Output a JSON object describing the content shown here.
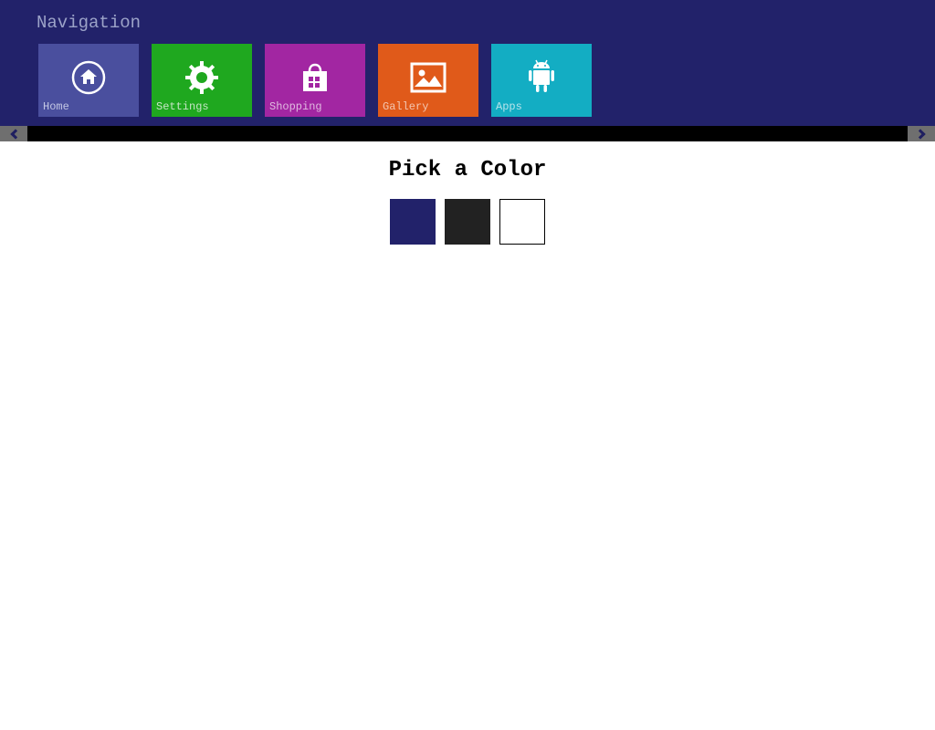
{
  "nav": {
    "title": "Navigation",
    "tiles": [
      {
        "label": "Home",
        "color": "#4a4f9e"
      },
      {
        "label": "Settings",
        "color": "#1fa81f"
      },
      {
        "label": "Shopping",
        "color": "#a226a2"
      },
      {
        "label": "Gallery",
        "color": "#e05a1a"
      },
      {
        "label": "Apps",
        "color": "#13adc3"
      }
    ]
  },
  "picker": {
    "title": "Pick a Color",
    "colors": [
      "#22226a",
      "#222222",
      "#ffffff"
    ]
  }
}
